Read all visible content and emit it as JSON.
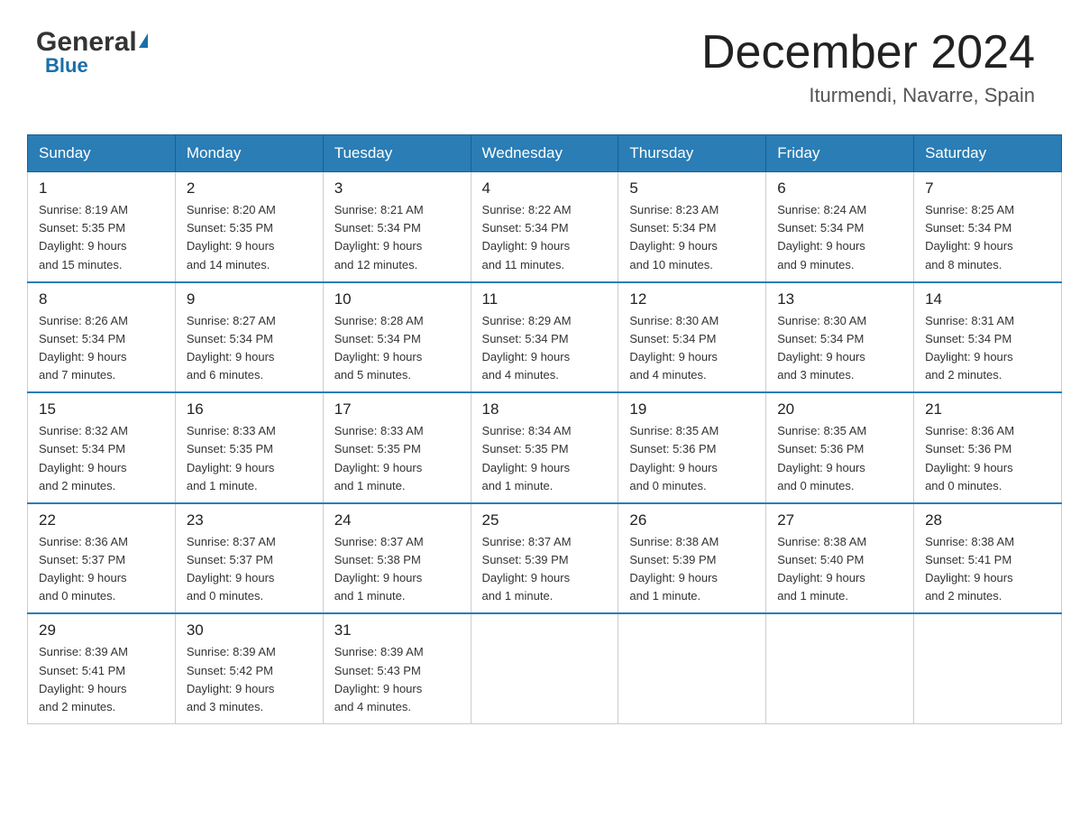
{
  "header": {
    "logo_general": "General",
    "logo_blue": "Blue",
    "month_title": "December 2024",
    "location": "Iturmendi, Navarre, Spain"
  },
  "weekdays": [
    "Sunday",
    "Monday",
    "Tuesday",
    "Wednesday",
    "Thursday",
    "Friday",
    "Saturday"
  ],
  "weeks": [
    [
      {
        "day": "1",
        "sunrise": "8:19 AM",
        "sunset": "5:35 PM",
        "daylight": "9 hours and 15 minutes."
      },
      {
        "day": "2",
        "sunrise": "8:20 AM",
        "sunset": "5:35 PM",
        "daylight": "9 hours and 14 minutes."
      },
      {
        "day": "3",
        "sunrise": "8:21 AM",
        "sunset": "5:34 PM",
        "daylight": "9 hours and 12 minutes."
      },
      {
        "day": "4",
        "sunrise": "8:22 AM",
        "sunset": "5:34 PM",
        "daylight": "9 hours and 11 minutes."
      },
      {
        "day": "5",
        "sunrise": "8:23 AM",
        "sunset": "5:34 PM",
        "daylight": "9 hours and 10 minutes."
      },
      {
        "day": "6",
        "sunrise": "8:24 AM",
        "sunset": "5:34 PM",
        "daylight": "9 hours and 9 minutes."
      },
      {
        "day": "7",
        "sunrise": "8:25 AM",
        "sunset": "5:34 PM",
        "daylight": "9 hours and 8 minutes."
      }
    ],
    [
      {
        "day": "8",
        "sunrise": "8:26 AM",
        "sunset": "5:34 PM",
        "daylight": "9 hours and 7 minutes."
      },
      {
        "day": "9",
        "sunrise": "8:27 AM",
        "sunset": "5:34 PM",
        "daylight": "9 hours and 6 minutes."
      },
      {
        "day": "10",
        "sunrise": "8:28 AM",
        "sunset": "5:34 PM",
        "daylight": "9 hours and 5 minutes."
      },
      {
        "day": "11",
        "sunrise": "8:29 AM",
        "sunset": "5:34 PM",
        "daylight": "9 hours and 4 minutes."
      },
      {
        "day": "12",
        "sunrise": "8:30 AM",
        "sunset": "5:34 PM",
        "daylight": "9 hours and 4 minutes."
      },
      {
        "day": "13",
        "sunrise": "8:30 AM",
        "sunset": "5:34 PM",
        "daylight": "9 hours and 3 minutes."
      },
      {
        "day": "14",
        "sunrise": "8:31 AM",
        "sunset": "5:34 PM",
        "daylight": "9 hours and 2 minutes."
      }
    ],
    [
      {
        "day": "15",
        "sunrise": "8:32 AM",
        "sunset": "5:34 PM",
        "daylight": "9 hours and 2 minutes."
      },
      {
        "day": "16",
        "sunrise": "8:33 AM",
        "sunset": "5:35 PM",
        "daylight": "9 hours and 1 minute."
      },
      {
        "day": "17",
        "sunrise": "8:33 AM",
        "sunset": "5:35 PM",
        "daylight": "9 hours and 1 minute."
      },
      {
        "day": "18",
        "sunrise": "8:34 AM",
        "sunset": "5:35 PM",
        "daylight": "9 hours and 1 minute."
      },
      {
        "day": "19",
        "sunrise": "8:35 AM",
        "sunset": "5:36 PM",
        "daylight": "9 hours and 0 minutes."
      },
      {
        "day": "20",
        "sunrise": "8:35 AM",
        "sunset": "5:36 PM",
        "daylight": "9 hours and 0 minutes."
      },
      {
        "day": "21",
        "sunrise": "8:36 AM",
        "sunset": "5:36 PM",
        "daylight": "9 hours and 0 minutes."
      }
    ],
    [
      {
        "day": "22",
        "sunrise": "8:36 AM",
        "sunset": "5:37 PM",
        "daylight": "9 hours and 0 minutes."
      },
      {
        "day": "23",
        "sunrise": "8:37 AM",
        "sunset": "5:37 PM",
        "daylight": "9 hours and 0 minutes."
      },
      {
        "day": "24",
        "sunrise": "8:37 AM",
        "sunset": "5:38 PM",
        "daylight": "9 hours and 1 minute."
      },
      {
        "day": "25",
        "sunrise": "8:37 AM",
        "sunset": "5:39 PM",
        "daylight": "9 hours and 1 minute."
      },
      {
        "day": "26",
        "sunrise": "8:38 AM",
        "sunset": "5:39 PM",
        "daylight": "9 hours and 1 minute."
      },
      {
        "day": "27",
        "sunrise": "8:38 AM",
        "sunset": "5:40 PM",
        "daylight": "9 hours and 1 minute."
      },
      {
        "day": "28",
        "sunrise": "8:38 AM",
        "sunset": "5:41 PM",
        "daylight": "9 hours and 2 minutes."
      }
    ],
    [
      {
        "day": "29",
        "sunrise": "8:39 AM",
        "sunset": "5:41 PM",
        "daylight": "9 hours and 2 minutes."
      },
      {
        "day": "30",
        "sunrise": "8:39 AM",
        "sunset": "5:42 PM",
        "daylight": "9 hours and 3 minutes."
      },
      {
        "day": "31",
        "sunrise": "8:39 AM",
        "sunset": "5:43 PM",
        "daylight": "9 hours and 4 minutes."
      },
      null,
      null,
      null,
      null
    ]
  ]
}
